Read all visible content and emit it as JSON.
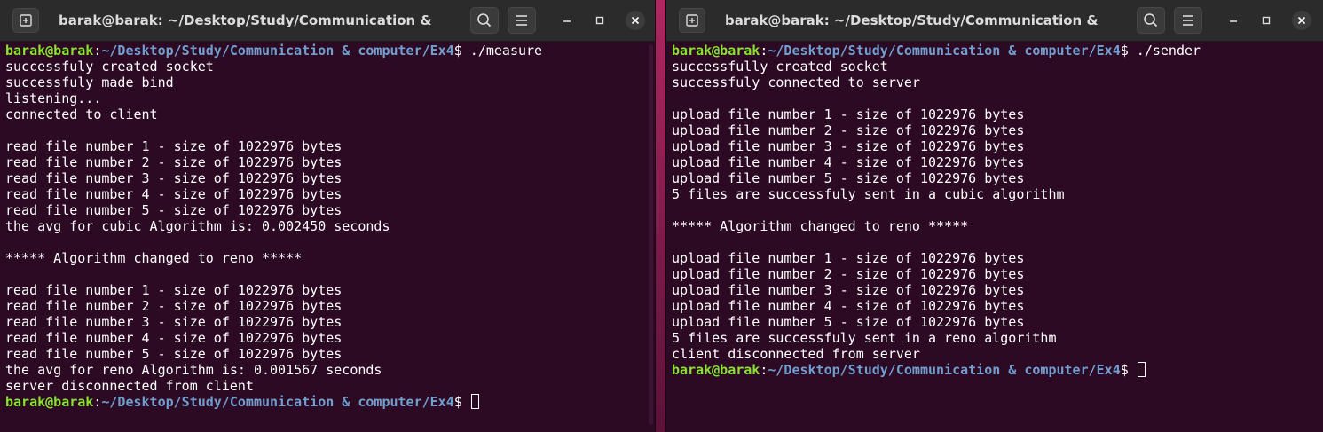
{
  "prompt": {
    "user_host": "barak@barak",
    "separator": ":",
    "path": "~/Desktop/Study/Communication & computer/Ex4",
    "dollar": "$ "
  },
  "terminals": {
    "left": {
      "title": "barak@barak: ~/Desktop/Study/Communication & computer/...",
      "command": "./measure",
      "output": [
        "successfuly created socket",
        "successfuly made bind",
        "listening...",
        "connected to client",
        "",
        "read file number 1 - size of 1022976 bytes",
        "read file number 2 - size of 1022976 bytes",
        "read file number 3 - size of 1022976 bytes",
        "read file number 4 - size of 1022976 bytes",
        "read file number 5 - size of 1022976 bytes",
        "the avg for cubic Algorithm is: 0.002450 seconds",
        "",
        "***** Algorithm changed to reno *****",
        "",
        "read file number 1 - size of 1022976 bytes",
        "read file number 2 - size of 1022976 bytes",
        "read file number 3 - size of 1022976 bytes",
        "read file number 4 - size of 1022976 bytes",
        "read file number 5 - size of 1022976 bytes",
        "the avg for reno Algorithm is: 0.001567 seconds",
        "server disconnected from client"
      ]
    },
    "right": {
      "title": "barak@barak: ~/Desktop/Study/Communication & computer/...",
      "command": "./sender",
      "output": [
        "successfully created socket",
        "successfuly connected to server",
        "",
        "upload file number 1 - size of 1022976 bytes",
        "upload file number 2 - size of 1022976 bytes",
        "upload file number 3 - size of 1022976 bytes",
        "upload file number 4 - size of 1022976 bytes",
        "upload file number 5 - size of 1022976 bytes",
        "5 files are successfuly sent in a cubic algorithm",
        "",
        "***** Algorithm changed to reno *****",
        "",
        "upload file number 1 - size of 1022976 bytes",
        "upload file number 2 - size of 1022976 bytes",
        "upload file number 3 - size of 1022976 bytes",
        "upload file number 4 - size of 1022976 bytes",
        "upload file number 5 - size of 1022976 bytes",
        "5 files are successfuly sent in a reno algorithm",
        "client disconnected from server"
      ]
    }
  },
  "icons": {
    "new_tab": "new-tab-icon",
    "search": "search-icon",
    "menu": "hamburger-menu-icon",
    "minimize": "minimize-icon",
    "maximize": "maximize-icon",
    "close": "close-icon"
  },
  "colors": {
    "terminal_bg": "#2c0a23",
    "titlebar_bg": "#2b2b2b",
    "prompt_user": "#8ae234",
    "prompt_path": "#729fcf",
    "text": "#ffffff"
  }
}
